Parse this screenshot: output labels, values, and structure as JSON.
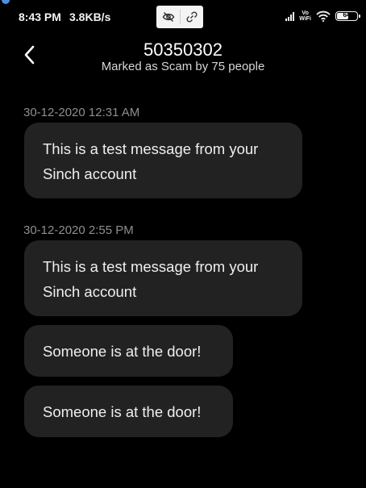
{
  "status_bar": {
    "time": "8:43 PM",
    "network_speed": "3.8KB/s",
    "vowifi_line1": "Vo",
    "vowifi_line2": "WiFi",
    "battery_level": "64",
    "battery_fraction": 0.64,
    "icons": [
      "eye-off-icon",
      "link-icon",
      "signal-icon",
      "vowifi-icon",
      "wifi-icon",
      "battery-icon"
    ]
  },
  "header": {
    "title": "50350302",
    "subtitle": "Marked as Scam by 75 people",
    "back_icon": "chevron-left-icon"
  },
  "conversation": [
    {
      "timestamp": "30-12-2020 12:31 AM",
      "messages": [
        "This is a test message from your Sinch account"
      ]
    },
    {
      "timestamp": "30-12-2020 2:55 PM",
      "messages": [
        "This is a test message from your Sinch account",
        "Someone is at the door!",
        "Someone is at the door!"
      ]
    }
  ],
  "colors": {
    "background": "#000000",
    "bubble": "#222222",
    "timestamp": "#8e8e8e",
    "text": "#efefef"
  }
}
